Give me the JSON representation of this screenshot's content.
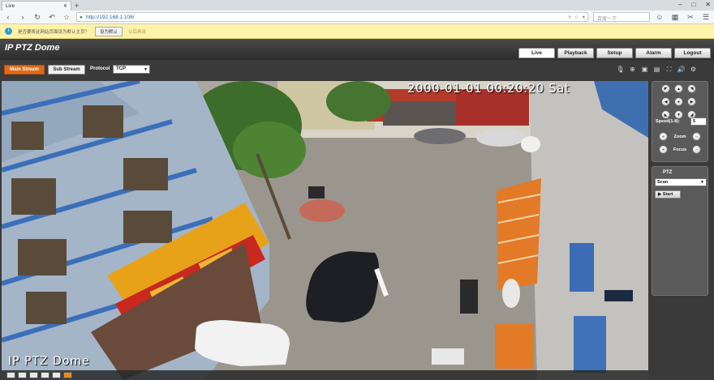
{
  "browser": {
    "tab_title": "Live",
    "new_tab_icon": "+",
    "window_controls": [
      "–",
      "□",
      "✕"
    ],
    "address": "http://192.168.1.108/",
    "search_placeholder": "百度一下",
    "nav_icons": [
      "back-icon",
      "forward-icon",
      "reload-icon",
      "undo-icon",
      "star-icon"
    ],
    "notice_text": "是否要将此网站页面设为默认主页？",
    "notice_button": "设为默认",
    "notice_dismiss": "以后再说"
  },
  "app": {
    "brand": "IP PTZ Dome",
    "menu": [
      {
        "label": "Live",
        "active": true
      },
      {
        "label": "Playback",
        "active": false
      },
      {
        "label": "Setup",
        "active": false
      },
      {
        "label": "Alarm",
        "active": false
      },
      {
        "label": "Logout",
        "active": false
      }
    ],
    "toolbar": {
      "main_stream": "Main Stream",
      "sub_stream": "Sub Stream",
      "protocol_label": "Protocol",
      "protocol_value": "TCP"
    }
  },
  "video": {
    "osd_time": "2000-01-01 00:20:20 Sat",
    "osd_name": "IP PTZ Dome"
  },
  "ptz": {
    "speed_label": "Speed(1-8):",
    "speed_value": "5",
    "zoom_label": "Zoom",
    "focus_label": "Focus",
    "section_label": "PTZ",
    "scan_value": "Scan",
    "start_label": "Start"
  },
  "colors": {
    "accent_orange": "#e06a1b",
    "notice_bg": "#fff3a8",
    "app_bg": "#3a3a3a"
  }
}
